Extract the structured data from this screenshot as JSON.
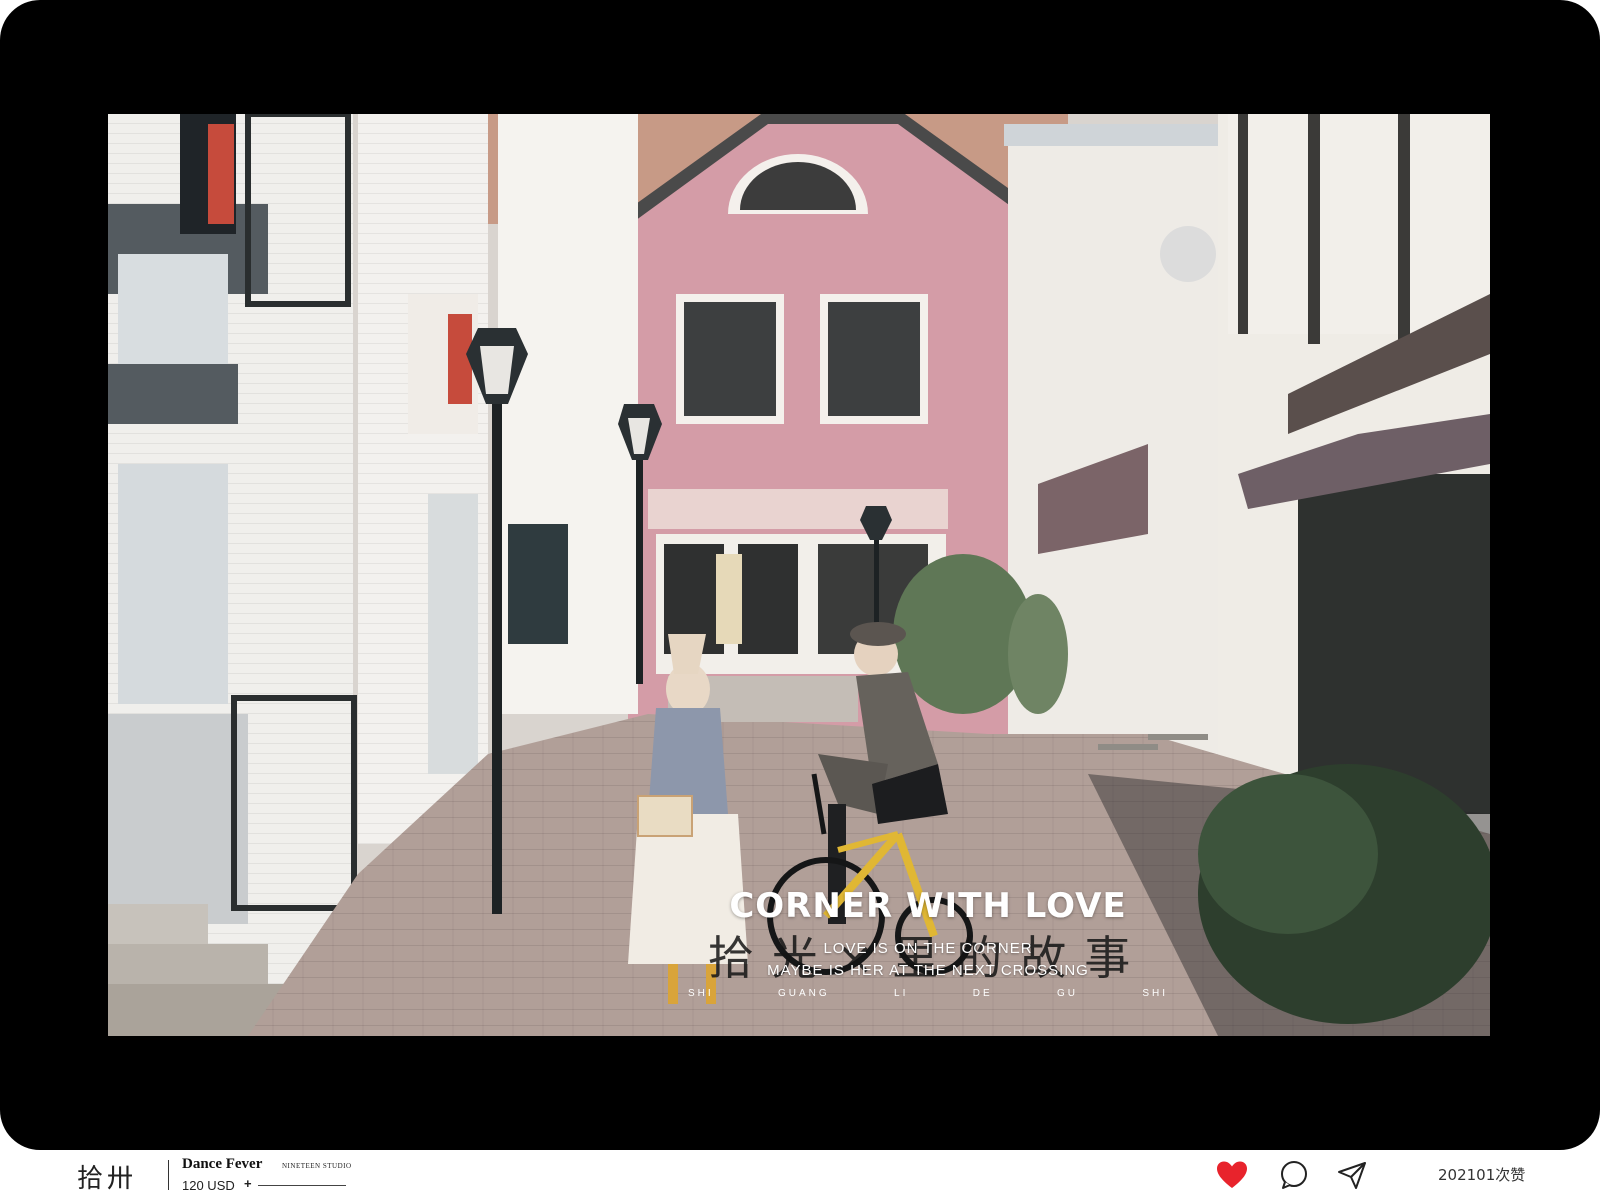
{
  "photo": {
    "overlay_title": "CORNER WITH LOVE",
    "overlay_chinese": "拾光×里的故事",
    "overlay_lines": [
      "LOVE IS ON THE CORNER",
      "MAYBE IS HER AT THE NEXT CROSSING"
    ],
    "overlay_pinyin": [
      "SHI",
      "GUANG",
      "LI",
      "DE",
      "GU",
      "SHI"
    ]
  },
  "footer": {
    "brand_mark": "拾卅",
    "title": "Dance Fever",
    "studio": "NINETEEN STUDIO",
    "price": "120 USD",
    "plus": "+",
    "likes": "202101次赞"
  },
  "icons": {
    "like": "heart-icon",
    "comment": "comment-icon",
    "share": "send-icon"
  },
  "colors": {
    "frame": "#000000",
    "heart": "#e8232c",
    "background": "#ffffff"
  }
}
